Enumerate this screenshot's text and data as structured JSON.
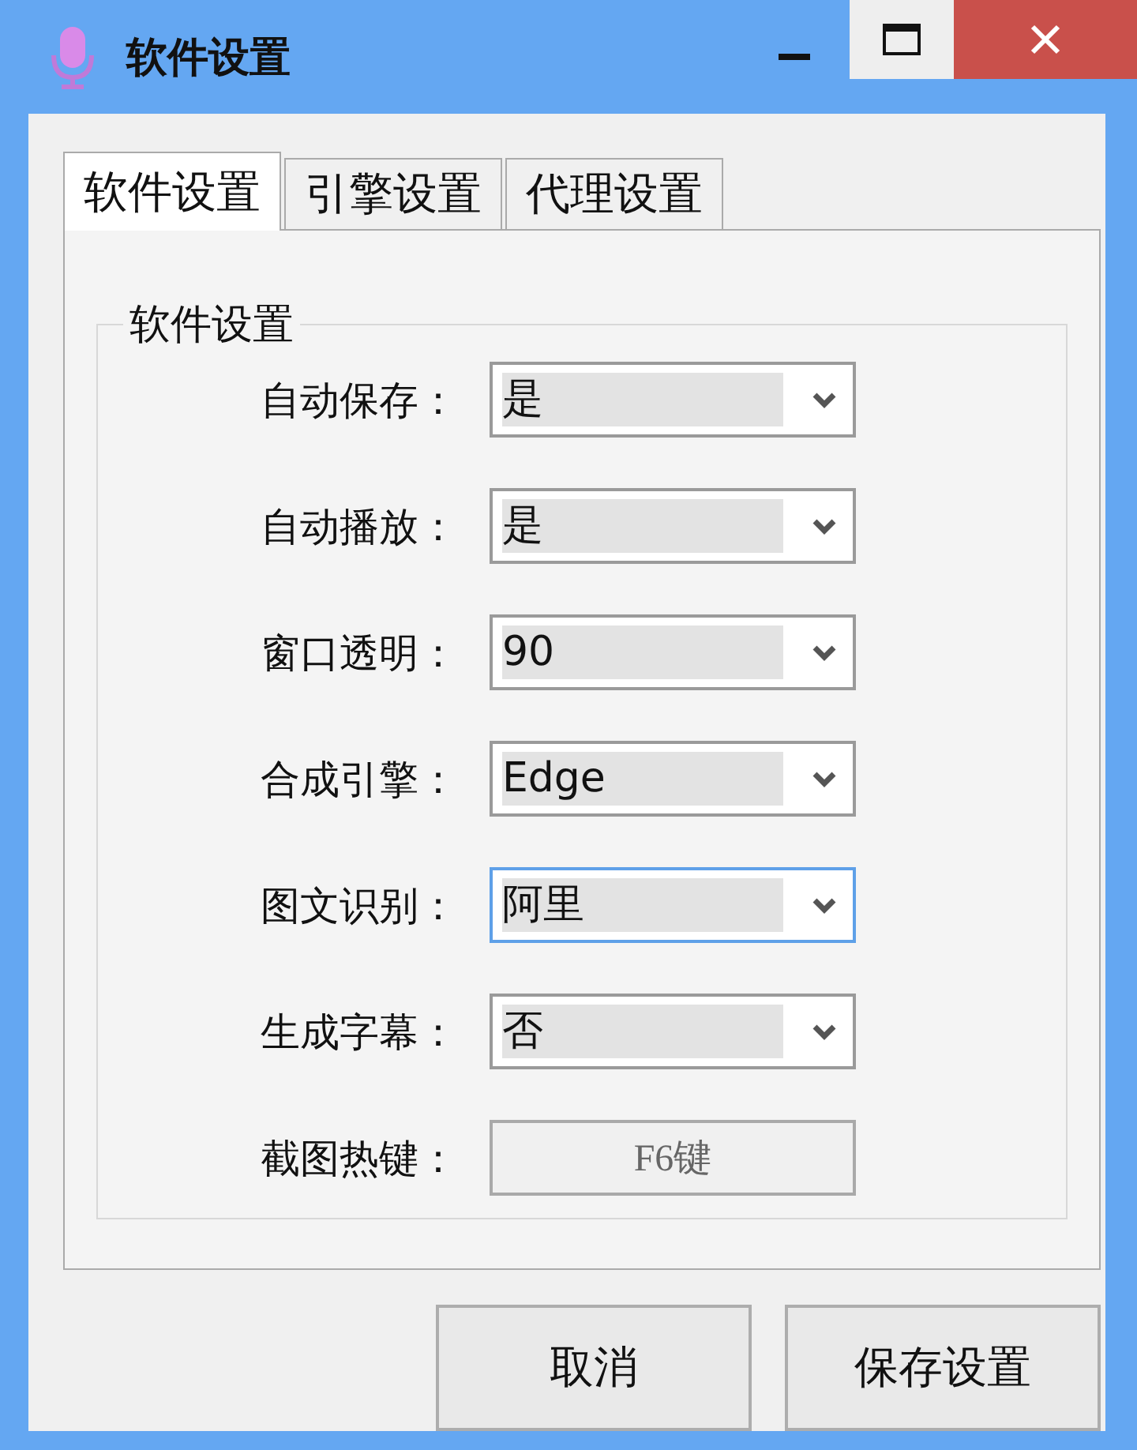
{
  "window": {
    "title": "软件设置"
  },
  "tabs": [
    {
      "label": "软件设置",
      "selected": true
    },
    {
      "label": "引擎设置",
      "selected": false
    },
    {
      "label": "代理设置",
      "selected": false
    }
  ],
  "group": {
    "title": "软件设置"
  },
  "settings": [
    {
      "kind": "combo",
      "label": "自动保存：",
      "value": "是",
      "focused": false
    },
    {
      "kind": "combo",
      "label": "自动播放：",
      "value": "是",
      "focused": false
    },
    {
      "kind": "combo",
      "label": "窗口透明：",
      "value": "90",
      "focused": false
    },
    {
      "kind": "combo",
      "label": "合成引擎：",
      "value": "Edge",
      "focused": false
    },
    {
      "kind": "combo",
      "label": "图文识别：",
      "value": "阿里",
      "focused": true
    },
    {
      "kind": "combo",
      "label": "生成字幕：",
      "value": "否",
      "focused": false
    },
    {
      "kind": "hotkey",
      "label": "截图热键：",
      "value": "F6键"
    }
  ],
  "buttons": [
    "取消",
    "保存设置"
  ]
}
